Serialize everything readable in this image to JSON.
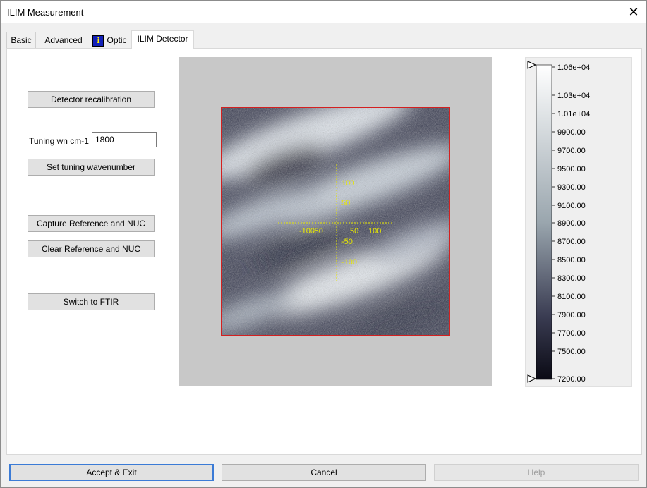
{
  "window": {
    "title": "ILIM Measurement"
  },
  "tabs": [
    {
      "label": "Basic"
    },
    {
      "label": "Advanced"
    },
    {
      "label": "Optic",
      "icon": "info-icon"
    },
    {
      "label": "ILIM Detector",
      "active": true
    }
  ],
  "left": {
    "recalibration_label": "Detector recalibration",
    "tuning_label": "Tuning wn cm-1",
    "tuning_value": "1800",
    "set_tuning_label": "Set tuning wavenumber",
    "capture_label": "Capture Reference and NUC",
    "clear_label": "Clear Reference and NUC",
    "switch_label": "Switch to FTIR"
  },
  "image": {
    "axis_color": "#e8e800",
    "x_ticks": [
      "-100",
      "-50",
      "50",
      "100"
    ],
    "y_ticks": [
      "100",
      "50",
      "-50",
      "-100"
    ]
  },
  "colorbar": {
    "labels": [
      "1.06e+04",
      "1.03e+04",
      "1.01e+04",
      "9900.00",
      "9700.00",
      "9500.00",
      "9300.00",
      "9100.00",
      "8900.00",
      "8700.00",
      "8500.00",
      "8300.00",
      "8100.00",
      "7900.00",
      "7700.00",
      "7500.00",
      "7200.00"
    ],
    "high_color": "#ffffff",
    "low_color": "#0a0a14"
  },
  "footer": {
    "accept_label": "Accept & Exit",
    "cancel_label": "Cancel",
    "help_label": "Help"
  }
}
